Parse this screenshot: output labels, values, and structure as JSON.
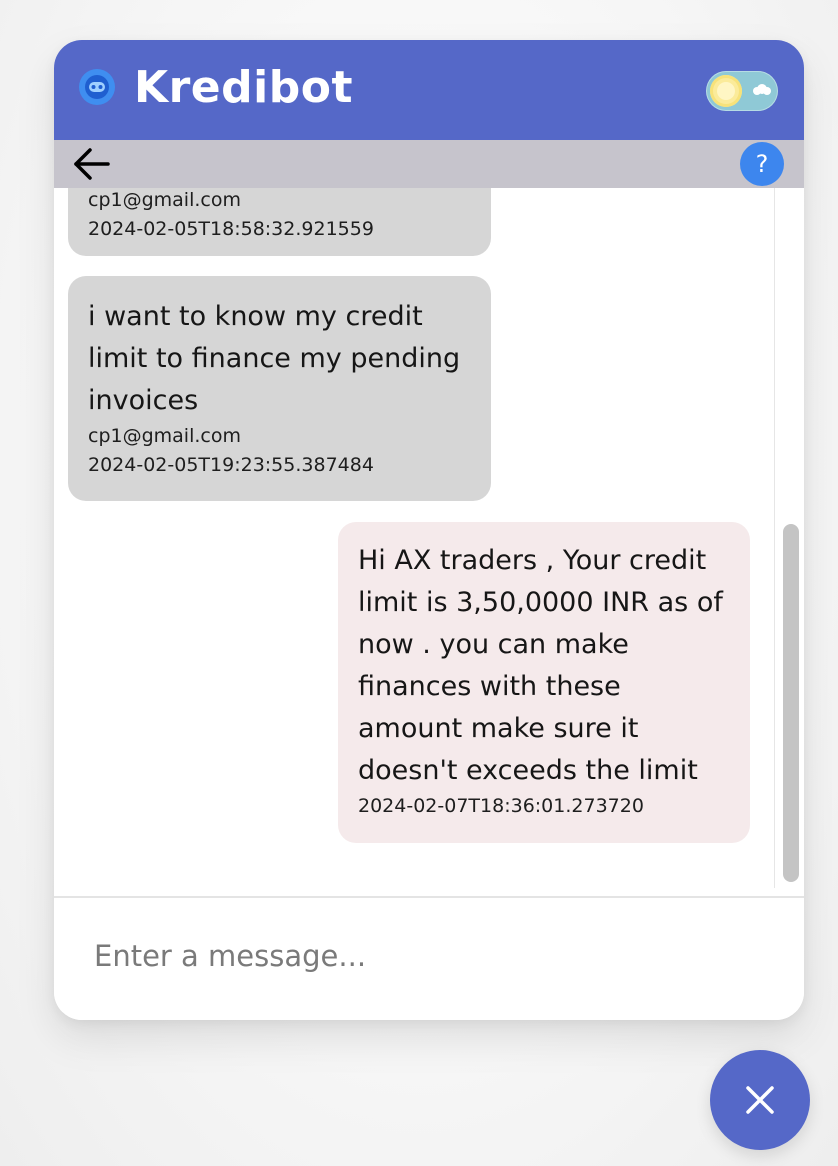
{
  "header": {
    "title": "Kredibot",
    "logo_icon": "robot-icon",
    "theme_toggle_icon": "sun-icon",
    "colors": {
      "header_bg": "#5568c8",
      "subbar_bg": "#c6c4cc",
      "help_bg": "#3d86ee",
      "user_bubble_bg": "#d6d6d6",
      "bot_bubble_bg": "#f5eaeb"
    }
  },
  "subbar": {
    "back_icon": "arrow-left-icon",
    "help_label": "?"
  },
  "messages": [
    {
      "sender": "user",
      "text": "",
      "email": "cp1@gmail.com",
      "timestamp": "2024-02-05T18:58:32.921559"
    },
    {
      "sender": "user",
      "text": "i want to know my credit limit to finance my pending invoices",
      "email": "cp1@gmail.com",
      "timestamp": "2024-02-05T19:23:55.387484"
    },
    {
      "sender": "bot",
      "text": "Hi AX traders , Your credit limit is 3,50,0000 INR as of now . you can make finances with these amount make sure it doesn't exceeds the limit",
      "timestamp": "2024-02-07T18:36:01.273720"
    }
  ],
  "composer": {
    "placeholder": "Enter a message..."
  },
  "fab": {
    "icon": "close-icon"
  }
}
